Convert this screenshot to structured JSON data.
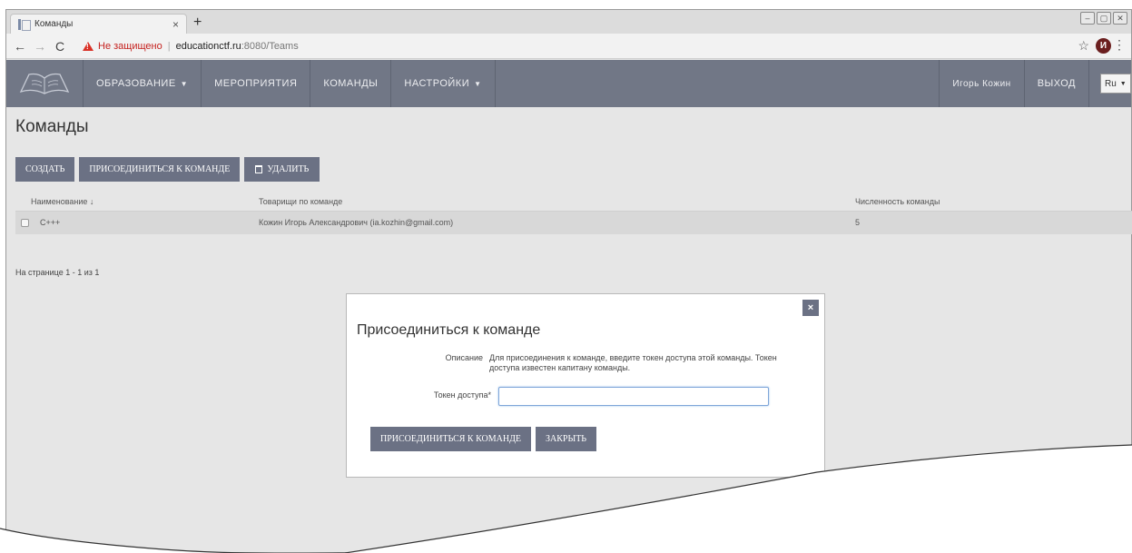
{
  "browser": {
    "tab_title": "Команды",
    "tab_close": "×",
    "new_tab": "+",
    "win_controls": [
      "–",
      "▢",
      "✕"
    ],
    "nav": {
      "back": "←",
      "forward": "→",
      "reload": "C"
    },
    "insecure_label": "Не защищено",
    "separator": "|",
    "url_host": "educationctf.ru",
    "url_rest": ":8080/Teams",
    "star": "☆",
    "avatar_letter": "И",
    "menu": "⋮"
  },
  "navbar": {
    "items": [
      {
        "label": "ОБРАЗОВАНИЕ",
        "has_caret": true
      },
      {
        "label": "МЕРОПРИЯТИЯ"
      },
      {
        "label": "КОМАНДЫ"
      },
      {
        "label": "НАСТРОЙКИ",
        "has_caret": true
      }
    ],
    "caret": "▼",
    "user_name": "Игорь Кожин",
    "logout": "ВЫХОД",
    "lang": "Ru",
    "lang_caret": "▼",
    "nav_color": "#717786"
  },
  "page": {
    "title": "Команды",
    "toolbar": {
      "create": "СОЗДАТЬ",
      "join": "ПРИСОЕДИНИТЬСЯ К КОМАНДЕ",
      "delete": "УДАЛИТЬ"
    },
    "table": {
      "columns": [
        "Наименование ↓",
        "Товарищи по команде",
        "Численность команды"
      ],
      "rows": [
        {
          "name": "C+++",
          "members": "Кожин Игорь Александрович (ia.kozhin@gmail.com)",
          "count": "5"
        }
      ]
    },
    "pager": "На странице 1 - 1 из 1"
  },
  "modal": {
    "close": "×",
    "title": "Присоединиться к команде",
    "desc_label": "Описание",
    "description": "Для присоединения к команде, введите токен доступа этой команды. Токен доступа известен капитану команды.",
    "token_label": "Токен доступа*",
    "token_value": "",
    "join_button": "ПРИСОЕДИНИТЬСЯ К КОМАНДЕ",
    "close_button": "ЗАКРЫТЬ"
  },
  "colors": {
    "button": "#6b7184",
    "background": "#e6e6e6",
    "insecure": "#c5221f"
  }
}
